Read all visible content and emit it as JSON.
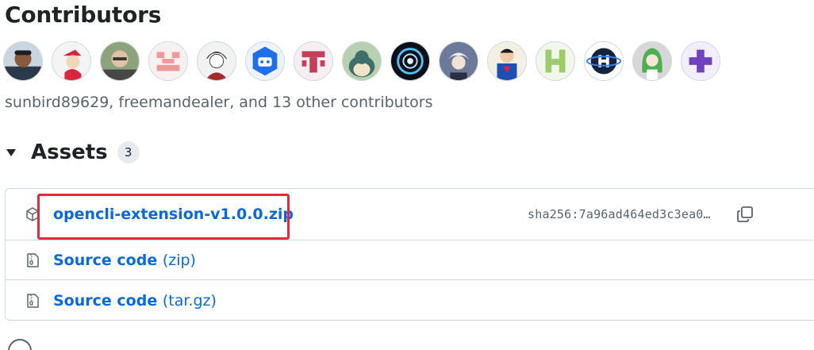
{
  "contributors": {
    "title": "Contributors",
    "summary": "sunbird89629, freemandealer, and 13 other contributors",
    "avatars": [
      {
        "name": "avatar-photo-man"
      },
      {
        "name": "avatar-cartoon-cap"
      },
      {
        "name": "avatar-photo-glasses"
      },
      {
        "name": "avatar-identicon-pink"
      },
      {
        "name": "avatar-anime-sketch"
      },
      {
        "name": "avatar-bot-blue"
      },
      {
        "name": "avatar-identicon-red"
      },
      {
        "name": "avatar-snorlax"
      },
      {
        "name": "avatar-arc-reactor"
      },
      {
        "name": "avatar-anime-white-hair"
      },
      {
        "name": "avatar-superman"
      },
      {
        "name": "avatar-identicon-green"
      },
      {
        "name": "avatar-h-logo"
      },
      {
        "name": "avatar-anime-green-hair"
      },
      {
        "name": "avatar-identicon-purple"
      }
    ]
  },
  "assets": {
    "title": "Assets",
    "count": "3",
    "items": [
      {
        "label": "opencli-extension-v1.0.0.zip",
        "sha": "sha256:7a96ad464ed3c3ea0…",
        "icon": "package-icon"
      },
      {
        "label": "Source code",
        "suffix": "(zip)",
        "icon": "file-zip-icon"
      },
      {
        "label": "Source code",
        "suffix": "(tar.gz)",
        "icon": "file-zip-icon"
      }
    ]
  },
  "colors": {
    "link": "#0969da",
    "highlight": "#e5283a",
    "muted": "#59636e"
  }
}
